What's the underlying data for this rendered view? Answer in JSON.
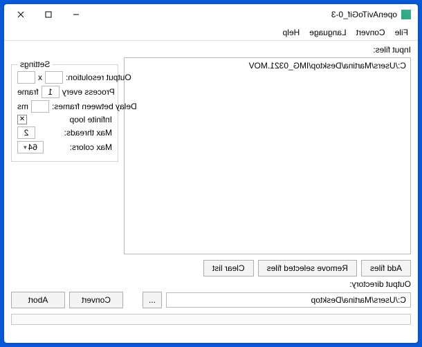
{
  "window": {
    "title": "openAviToGif_0-3"
  },
  "menu": {
    "file": "File",
    "convert": "Convert",
    "language": "Language",
    "help": "Help"
  },
  "labels": {
    "input_files": "Input files:",
    "output_directory": "Output directory:"
  },
  "files": [
    "C:/Users/Martina/Desktop/IMG_0321.MOV"
  ],
  "settings": {
    "legend": "Settings",
    "output_resolution": "Output resolution:",
    "res_w": "",
    "x": "x",
    "res_h": "",
    "process_every_pre": "Process every",
    "process_every_val": "1",
    "process_every_suf": "frame",
    "delay_label": "Delay between frames:",
    "delay_val": "",
    "delay_unit": "ms",
    "infinite_loop": "Infinite loop",
    "max_threads": "Max threads:",
    "max_threads_val": "2",
    "max_colors": "Max colors:",
    "max_colors_val": "64"
  },
  "buttons": {
    "add": "Add files",
    "remove": "Remove selected files",
    "clear": "Clear list",
    "browse": "...",
    "convert": "Convert",
    "abort": "Abort"
  },
  "output_path": "C:/Users/Martina/Desktop"
}
